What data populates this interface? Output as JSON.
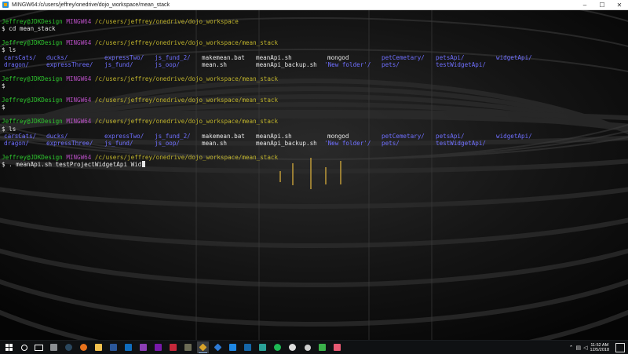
{
  "window": {
    "title": "MINGW64:/c/users/jeffrey/onedrive/dojo_workspace/mean_stack",
    "controls": {
      "minimize": "–",
      "maximize": "☐",
      "close": "✕"
    }
  },
  "prompt": {
    "user": "Jeffrey@JDKDesign",
    "host": "MINGW64",
    "symbol": "$"
  },
  "terminal": {
    "blocks": [
      {
        "path": "/c/users/jeffrey/onedrive/dojo_workspace",
        "command": "cd mean_stack"
      },
      {
        "path": "/c/users/jeffrey/onedrive/dojo_workspace/mean_stack",
        "command": "ls"
      },
      {
        "path": "/c/users/jeffrey/onedrive/dojo_workspace/mean_stack",
        "command": ""
      },
      {
        "path": "/c/users/jeffrey/onedrive/dojo_workspace/mean_stack",
        "command": ""
      },
      {
        "path": "/c/users/jeffrey/onedrive/dojo_workspace/mean_stack",
        "command": "ls"
      },
      {
        "path": "/c/users/jeffrey/onedrive/dojo_workspace/mean_stack",
        "command": ". meanApi.sh testProjectWidgetApi Wid"
      }
    ],
    "listing": {
      "row1": [
        "carsCats/",
        "ducks/",
        "expressTwo/",
        "js_fund_2/",
        "makemean.bat",
        "meanApi.sh",
        "mongod",
        "petCemetary/",
        "petsApi/",
        "widgetApi/"
      ],
      "row2": [
        "dragon/",
        "expressThree/",
        "js_fund/",
        "js_oop/",
        "mean.sh",
        "meanApi_backup.sh",
        "'New folder'/",
        "pets/",
        "testWidgetApi/",
        ""
      ]
    }
  },
  "taskbar": {
    "items": [
      "start-button",
      "search-button",
      "task-view-button",
      "file-manager",
      "steam",
      "firefox",
      "file-explorer",
      "word",
      "outlook",
      "app-purple",
      "onenote",
      "app-red",
      "app-dark",
      "git-bash",
      "sourcetree",
      "app-blue",
      "app-blue-2",
      "app-teal",
      "spotify",
      "github",
      "settings",
      "app-green",
      "app-pink"
    ],
    "clock_time": "11:52 AM",
    "clock_date": "12/5/2018"
  },
  "colors": {
    "user": "#2ec52e",
    "host": "#b84fc4",
    "path": "#c0b42c",
    "dir": "#6f6fff"
  }
}
